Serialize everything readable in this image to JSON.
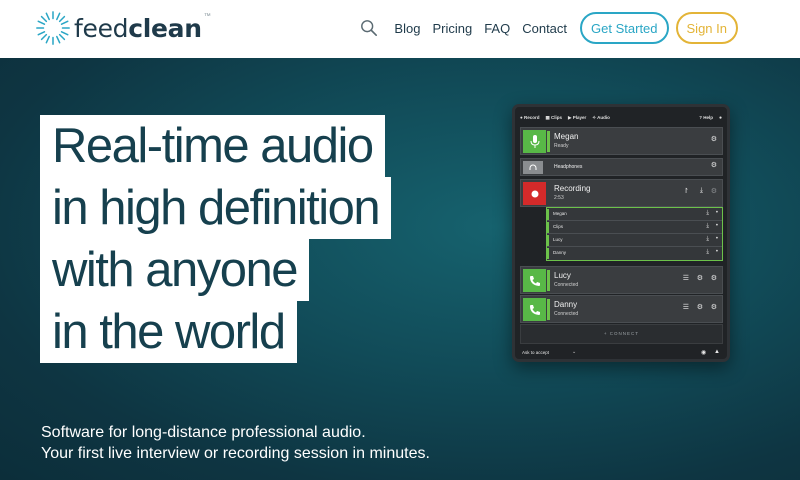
{
  "brand": {
    "name_bold": "clean",
    "name_light": "feed",
    "tm": "™"
  },
  "nav": {
    "links": [
      "Blog",
      "Pricing",
      "FAQ",
      "Contact"
    ],
    "get_started": "Get Started",
    "sign_in": "Sign In"
  },
  "hero": {
    "headline": [
      "Real-time audio",
      "in high definition",
      "with anyone",
      "in the world"
    ],
    "subtext": [
      "Software for long-distance professional audio.",
      "Your first live interview or recording session in minutes."
    ]
  },
  "app": {
    "tabs": [
      "Record",
      "Clips",
      "Player",
      "Audio"
    ],
    "help": "Help",
    "rows": [
      {
        "name": "Megan",
        "status": "Ready"
      },
      {
        "name": "Headphones",
        "status": ""
      },
      {
        "name": "Recording",
        "status": "2:53"
      },
      {
        "name": "Lucy",
        "status": "Connected"
      },
      {
        "name": "Danny",
        "status": "Connected"
      }
    ],
    "clips": [
      "Megan",
      "Clips",
      "Lucy",
      "Danny"
    ],
    "connect": "+ CONNECT",
    "ask": "Ask to accept"
  },
  "colors": {
    "accent_blue": "#2aa6c5",
    "accent_yellow": "#e3b437",
    "hero_bg": "#114b58",
    "headline_text": "#16404e",
    "app_green": "#58b847",
    "app_red": "#d42a2a"
  }
}
